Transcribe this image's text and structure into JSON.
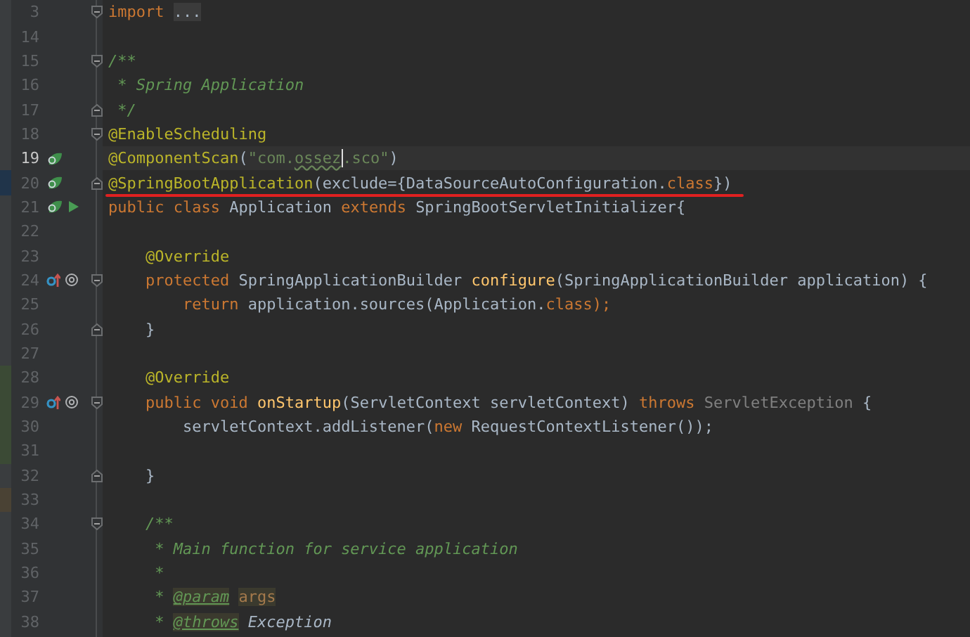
{
  "editor": {
    "lines": [
      {
        "number": "3",
        "current": false,
        "fold_start": true,
        "tokens": [
          {
            "t": "import",
            "kind": "keyword"
          },
          {
            "t": " ...",
            "kind": "folded"
          }
        ]
      },
      {
        "number": "14",
        "current": false
      },
      {
        "number": "15",
        "current": false,
        "fold_start": true,
        "tokens": [
          {
            "t": "/**",
            "kind": "doc"
          }
        ]
      },
      {
        "number": "16",
        "current": false,
        "tokens": [
          {
            "t": " * Spring Application",
            "kind": "doc"
          }
        ]
      },
      {
        "number": "17",
        "current": false,
        "fold_end": true,
        "tokens": [
          {
            "t": " */",
            "kind": "doc"
          }
        ]
      },
      {
        "number": "18",
        "current": false,
        "fold_start": true,
        "tokens": [
          {
            "t": "@EnableScheduling",
            "kind": "annotation"
          }
        ]
      },
      {
        "number": "19",
        "current": true,
        "markers": [
          {
            "kind": "bean"
          }
        ],
        "tokens": [
          {
            "t": "@ComponentScan",
            "kind": "annotation"
          },
          {
            "t": "(",
            "kind": "plain"
          },
          {
            "t": "\"com.",
            "kind": "string"
          },
          {
            "t": "ossez",
            "kind": "typo",
            "caret_after": true
          },
          {
            "t": ".sco\"",
            "kind": "string"
          },
          {
            "t": ")",
            "kind": "plain"
          }
        ]
      },
      {
        "number": "20",
        "current": false,
        "underlined": true,
        "fold_end": true,
        "change": {
          "kind": "modified"
        },
        "markers": [
          {
            "kind": "bean"
          }
        ],
        "tokens": [
          {
            "t": "@SpringBootApplication",
            "kind": "annotation"
          },
          {
            "t": "(exclude={DataSourceAutoConfiguration.",
            "kind": "plain"
          },
          {
            "t": "class",
            "kind": "keyword"
          },
          {
            "t": "})",
            "kind": "plain"
          }
        ]
      },
      {
        "number": "21",
        "current": false,
        "markers": [
          {
            "kind": "bean"
          },
          {
            "kind": "run"
          }
        ],
        "tokens": [
          {
            "t": "public class ",
            "kind": "keyword"
          },
          {
            "t": "Application ",
            "kind": "plain"
          },
          {
            "t": "extends ",
            "kind": "keyword"
          },
          {
            "t": "SpringBootServletInitializer{",
            "kind": "plain"
          }
        ]
      },
      {
        "number": "22",
        "current": false
      },
      {
        "number": "23",
        "current": false,
        "tokens": [
          {
            "t": "    @Override",
            "kind": "annotation"
          }
        ]
      },
      {
        "number": "24",
        "current": false,
        "fold_start": true,
        "markers": [
          {
            "kind": "override"
          },
          {
            "kind": "at"
          }
        ],
        "tokens": [
          {
            "t": "    protected ",
            "kind": "keyword"
          },
          {
            "t": "SpringApplicationBuilder ",
            "kind": "plain"
          },
          {
            "t": "configure",
            "kind": "function"
          },
          {
            "t": "(SpringApplicationBuilder application) {",
            "kind": "plain"
          }
        ]
      },
      {
        "number": "25",
        "current": false,
        "tokens": [
          {
            "t": "        return ",
            "kind": "keyword"
          },
          {
            "t": "application.sources(Application.",
            "kind": "plain"
          },
          {
            "t": "class",
            "kind": "keyword"
          },
          {
            "t": ");",
            "kind": "keyword"
          }
        ]
      },
      {
        "number": "26",
        "current": false,
        "fold_end": true,
        "tokens": [
          {
            "t": "    }",
            "kind": "plain"
          }
        ]
      },
      {
        "number": "27",
        "current": false
      },
      {
        "number": "28",
        "current": false,
        "change": {
          "kind": "added"
        },
        "tokens": [
          {
            "t": "    @Override",
            "kind": "annotation"
          }
        ]
      },
      {
        "number": "29",
        "current": false,
        "fold_start": true,
        "change": {
          "kind": "added"
        },
        "markers": [
          {
            "kind": "override"
          },
          {
            "kind": "at"
          }
        ],
        "tokens": [
          {
            "t": "    public void ",
            "kind": "keyword"
          },
          {
            "t": "onStartup",
            "kind": "function"
          },
          {
            "t": "(ServletContext servletContext) ",
            "kind": "plain"
          },
          {
            "t": "throws ",
            "kind": "keyword"
          },
          {
            "t": "ServletException ",
            "kind": "unused"
          },
          {
            "t": "{",
            "kind": "plain"
          }
        ]
      },
      {
        "number": "30",
        "current": false,
        "change": {
          "kind": "added"
        },
        "tokens": [
          {
            "t": "        servletContext.addListener(",
            "kind": "plain"
          },
          {
            "t": "new ",
            "kind": "keyword"
          },
          {
            "t": "RequestContextListener());",
            "kind": "plain"
          }
        ]
      },
      {
        "number": "31",
        "current": false,
        "change": {
          "kind": "added"
        }
      },
      {
        "number": "32",
        "current": false,
        "fold_end": true,
        "tokens": [
          {
            "t": "    }",
            "kind": "plain"
          }
        ]
      },
      {
        "number": "33",
        "current": false,
        "change": {
          "kind": "conflict"
        }
      },
      {
        "number": "34",
        "current": false,
        "fold_start": true,
        "tokens": [
          {
            "t": "    /**",
            "kind": "doc"
          }
        ]
      },
      {
        "number": "35",
        "current": false,
        "tokens": [
          {
            "t": "     * Main function for service application",
            "kind": "doc"
          }
        ]
      },
      {
        "number": "36",
        "current": false,
        "tokens": [
          {
            "t": "     *",
            "kind": "doc"
          }
        ]
      },
      {
        "number": "37",
        "current": false,
        "tokens": [
          {
            "t": "     * ",
            "kind": "doc"
          },
          {
            "t": "@param",
            "kind": "doctag"
          },
          {
            "t": " args",
            "kind": "param"
          }
        ]
      },
      {
        "number": "38",
        "current": false,
        "tokens": [
          {
            "t": "     * ",
            "kind": "doc"
          },
          {
            "t": "@throws",
            "kind": "doctag"
          },
          {
            "t": " Exception",
            "kind": "docref"
          }
        ]
      }
    ]
  }
}
